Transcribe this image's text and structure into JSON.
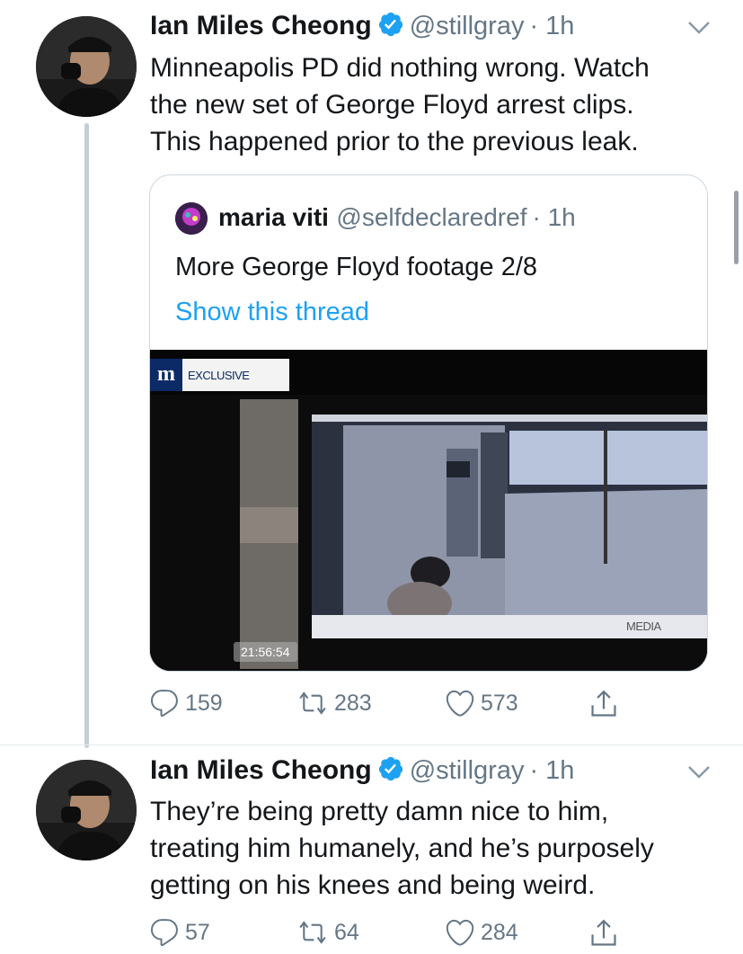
{
  "tweet1": {
    "name": "Ian Miles Cheong",
    "handle": "@stillgray",
    "time": "· 1h",
    "text_lines": [
      "Minneapolis PD did nothing wrong. Watch",
      "the new set of George Floyd arrest clips.",
      "This happened prior to the previous leak."
    ],
    "quote": {
      "name": "maria viti",
      "handle": "@selfdeclaredref",
      "time": "· 1h",
      "text": "More George Floyd footage 2/8",
      "show_thread": "Show this thread",
      "video": {
        "logo": "m",
        "badge": "EXCLUSIVE",
        "timestamp": "21:56:54",
        "watermark": "MEDIA"
      }
    },
    "actions": {
      "replies": "159",
      "retweets": "283",
      "likes": "573"
    }
  },
  "tweet2": {
    "name": "Ian Miles Cheong",
    "handle": "@stillgray",
    "time": "· 1h",
    "text_lines": [
      "They’re being pretty damn nice to him,",
      "treating him humanely, and he’s purposely",
      "getting on his knees and being weird."
    ],
    "actions": {
      "replies": "57",
      "retweets": "64",
      "likes": "284"
    }
  },
  "icons": {
    "verified": "verified-badge-icon",
    "chevron": "chevron-down-icon",
    "reply": "reply-icon",
    "retweet": "retweet-icon",
    "like": "heart-icon",
    "share": "share-icon"
  },
  "colors": {
    "accent": "#1da1f2",
    "secondary_text": "#657786",
    "thread_line": "#c4cfd6"
  }
}
